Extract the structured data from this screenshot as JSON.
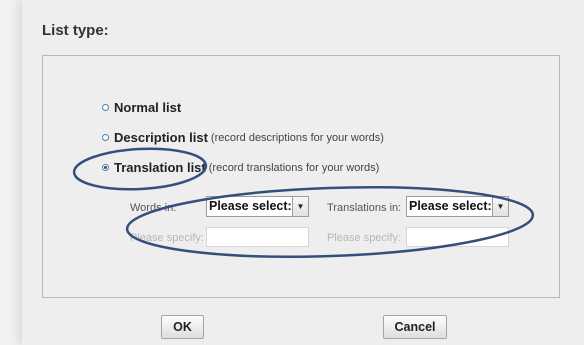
{
  "dialog": {
    "title": "List type:",
    "options": [
      {
        "label": "Normal list",
        "desc": "",
        "selected": false
      },
      {
        "label": "Description list",
        "desc": "(record descriptions for your words)",
        "selected": false
      },
      {
        "label": "Translation list",
        "desc": "(record translations for your words)",
        "selected": true
      }
    ],
    "words_in": {
      "label": "Words in:",
      "value": "Please select:",
      "specify_label": "Please specify:",
      "specify_value": ""
    },
    "translations_in": {
      "label": "Translations in:",
      "value": "Please select:",
      "specify_label": "Please specify:",
      "specify_value": ""
    },
    "ok_label": "OK",
    "cancel_label": "Cancel"
  },
  "colors": {
    "annotation": "#344f7c",
    "radio_border": "#4f7fb0"
  },
  "icons": {
    "dropdown": "chevron-down-icon"
  }
}
